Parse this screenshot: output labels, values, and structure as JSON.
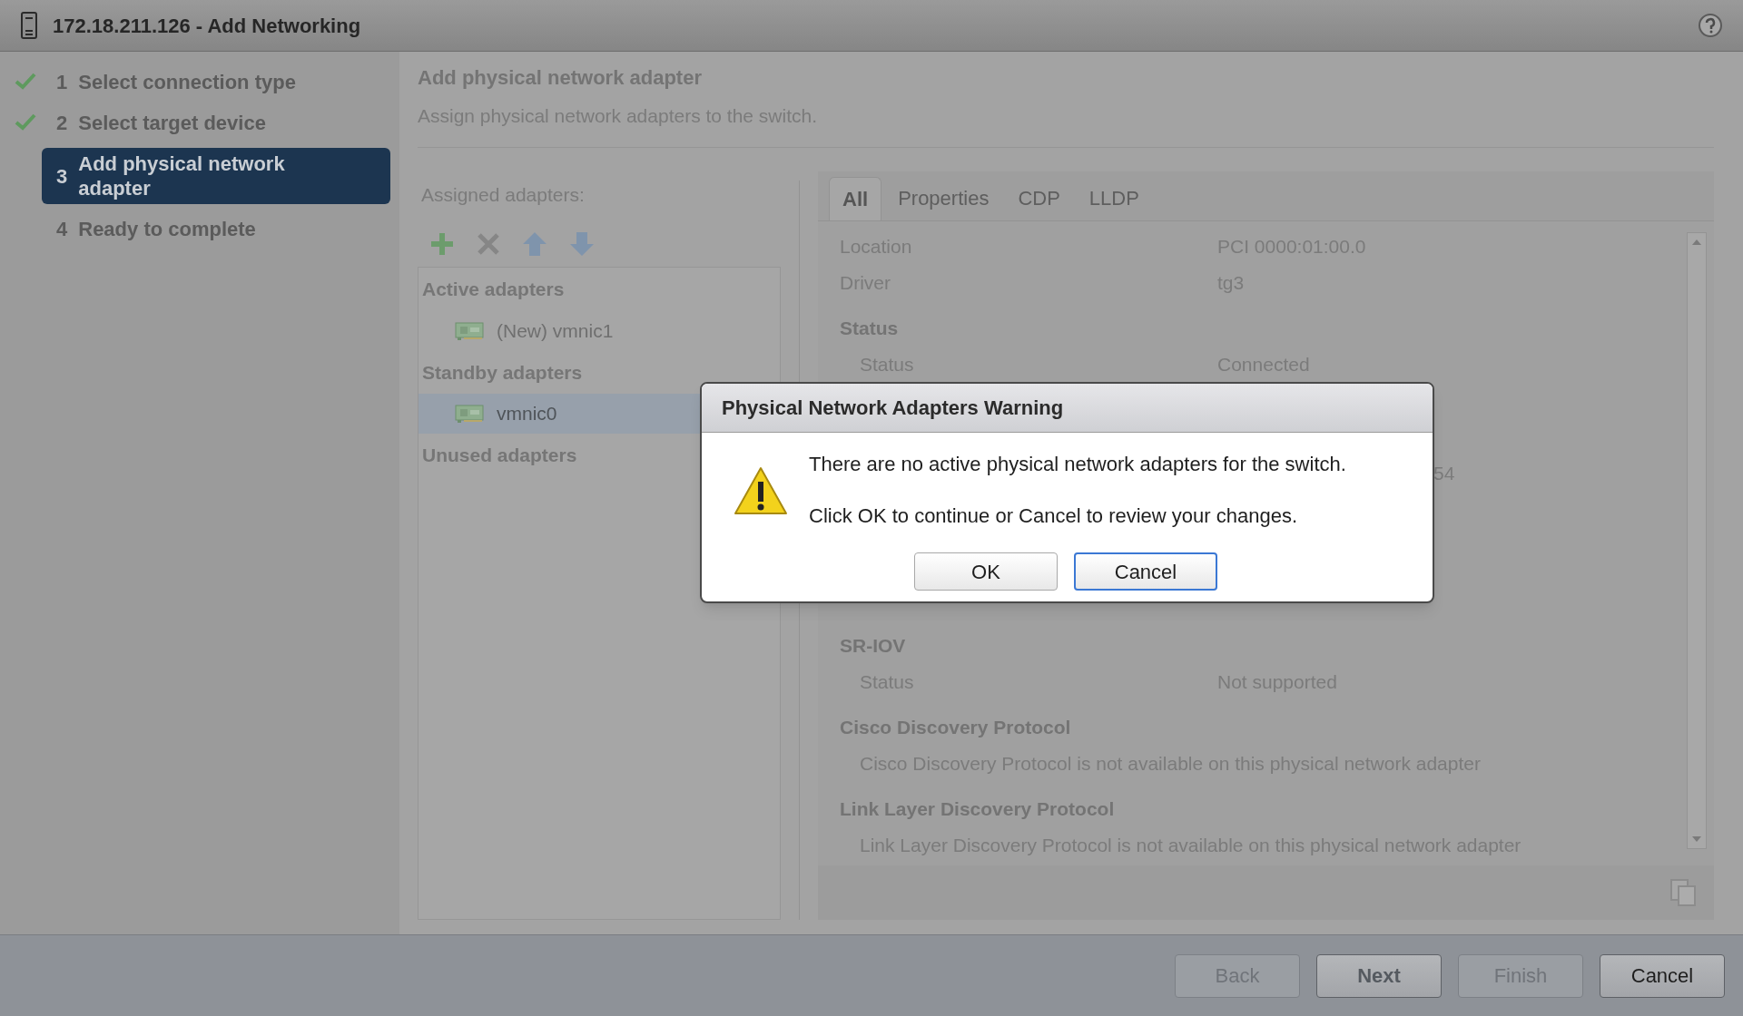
{
  "window": {
    "title": "172.18.211.126 - Add Networking"
  },
  "steps": [
    {
      "number": "1",
      "label": "Select connection type",
      "done": true,
      "selected": false
    },
    {
      "number": "2",
      "label": "Select target device",
      "done": true,
      "selected": false
    },
    {
      "number": "3",
      "label": "Add physical network adapter",
      "done": false,
      "selected": true
    },
    {
      "number": "4",
      "label": "Ready to complete",
      "done": false,
      "selected": false
    }
  ],
  "page": {
    "title": "Add physical network adapter",
    "subtitle": "Assign physical network adapters to the switch."
  },
  "assigned": {
    "label": "Assigned adapters:",
    "groups": [
      {
        "name": "Active adapters",
        "adapters": [
          {
            "name": "(New) vmnic1",
            "selected": false
          }
        ]
      },
      {
        "name": "Standby adapters",
        "adapters": [
          {
            "name": "vmnic0",
            "selected": true
          }
        ]
      },
      {
        "name": "Unused adapters"
      }
    ]
  },
  "tabs": [
    {
      "label": "All",
      "selected": true
    },
    {
      "label": "Properties",
      "selected": false
    },
    {
      "label": "CDP",
      "selected": false
    },
    {
      "label": "LLDP",
      "selected": false
    }
  ],
  "details": [
    {
      "kind": "row",
      "label": "Location",
      "value": "PCI 0000:01:00.0"
    },
    {
      "kind": "row",
      "label": "Driver",
      "value": "tg3"
    },
    {
      "kind": "heading",
      "label": "Status"
    },
    {
      "kind": "row",
      "label": "Status",
      "value": "Connected"
    },
    {
      "kind": "fragment",
      "value": "54"
    },
    {
      "kind": "heading",
      "label": "SR-IOV"
    },
    {
      "kind": "row",
      "label": "Status",
      "value": "Not supported"
    },
    {
      "kind": "heading",
      "label": "Cisco Discovery Protocol"
    },
    {
      "kind": "note",
      "label": "Cisco Discovery Protocol is not available on this physical network adapter"
    },
    {
      "kind": "heading",
      "label": "Link Layer Discovery Protocol"
    },
    {
      "kind": "note",
      "label": "Link Layer Discovery Protocol is not available on this physical network adapter"
    }
  ],
  "dialog": {
    "title": "Physical Network Adapters Warning",
    "messages": [
      "There are no active physical network adapters for the switch.",
      "Click OK to continue or Cancel to review your changes."
    ],
    "buttons": [
      {
        "label": "OK",
        "focused": false
      },
      {
        "label": "Cancel",
        "focused": true
      }
    ]
  },
  "footer": [
    {
      "label": "Back",
      "disabled": true,
      "primary": false
    },
    {
      "label": "Next",
      "disabled": false,
      "primary": true
    },
    {
      "label": "Finish",
      "disabled": true,
      "primary": false
    },
    {
      "label": "Cancel",
      "disabled": false,
      "primary": false
    }
  ]
}
